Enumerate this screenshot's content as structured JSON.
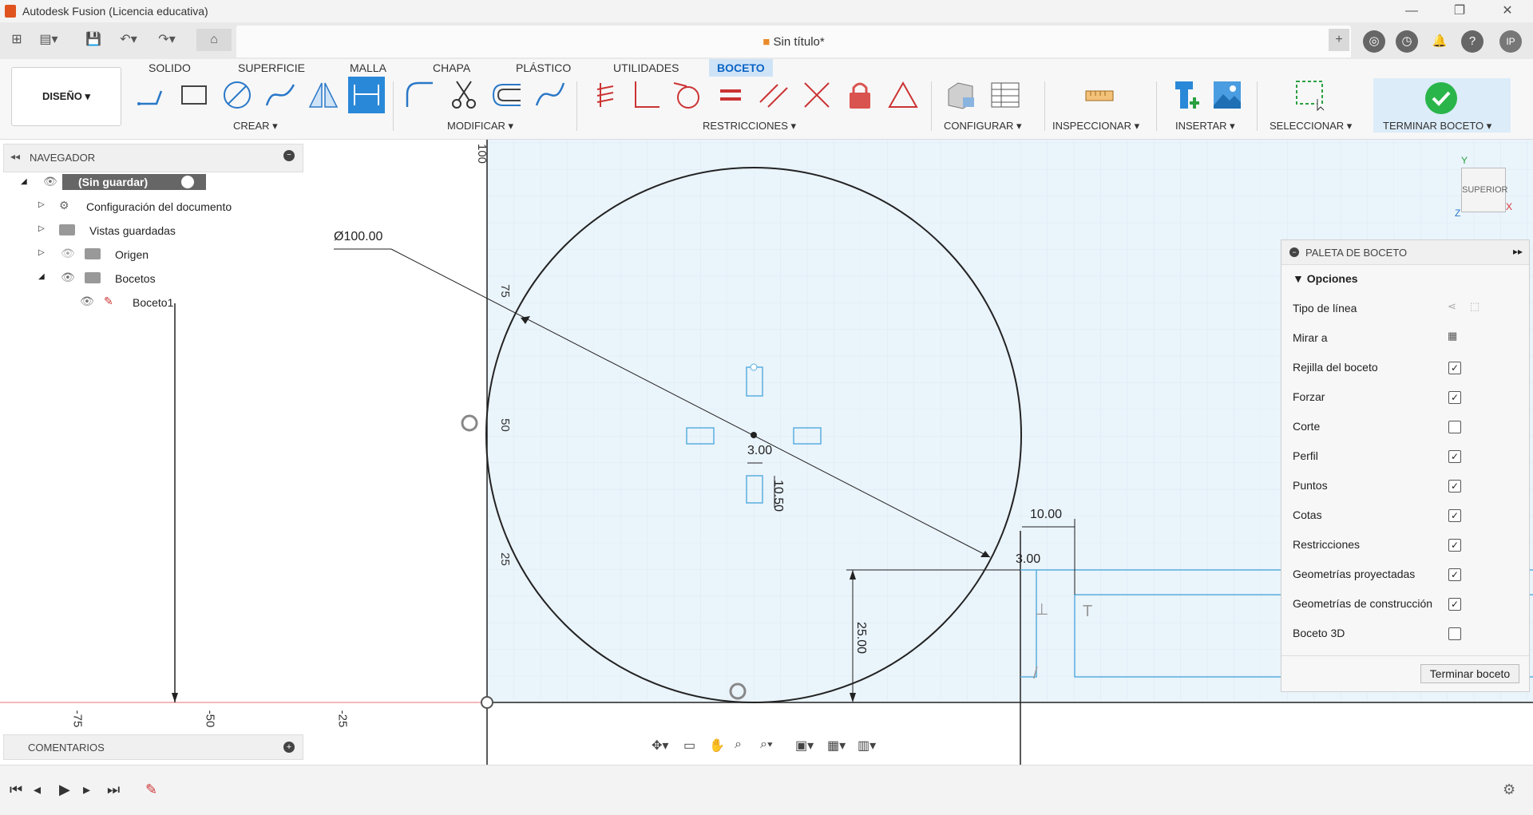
{
  "window": {
    "title": "Autodesk Fusion (Licencia educativa)"
  },
  "tabbar": {
    "doc_title": "Sin título*",
    "user_initials": "IP"
  },
  "ribbon": {
    "workspace": "DISEÑO ▾",
    "tabs": [
      "SOLIDO",
      "SUPERFICIE",
      "MALLA",
      "CHAPA",
      "PLÁSTICO",
      "UTILIDADES",
      "BOCETO"
    ],
    "active_tab": "BOCETO",
    "groups": {
      "crear": "CREAR ▾",
      "modificar": "MODIFICAR ▾",
      "restricciones": "RESTRICCIONES ▾",
      "configurar": "CONFIGURAR ▾",
      "inspeccionar": "INSPECCIONAR ▾",
      "insertar": "INSERTAR ▾",
      "seleccionar": "SELECCIONAR ▾",
      "terminar": "TERMINAR BOCETO ▾"
    },
    "accent": "#0a64c4"
  },
  "navigator": {
    "title": "NAVEGADOR",
    "root": "(Sin guardar)",
    "items": [
      {
        "label": "Configuración del documento",
        "icon": "gear-icon"
      },
      {
        "label": "Vistas guardadas",
        "icon": "folder-icon"
      },
      {
        "label": "Origen",
        "icon": "folder-icon"
      },
      {
        "label": "Bocetos",
        "icon": "folder-icon"
      },
      {
        "label": "Boceto1",
        "icon": "sketch-icon"
      }
    ]
  },
  "sketch": {
    "dim_diameter": "Ø100.00",
    "dim_a": "3.00",
    "dim_b": "10.50",
    "dim_c": "10.00",
    "dim_d": "3.00",
    "dim_e": "25.00",
    "ruler_v": [
      "100",
      "75",
      "50",
      "25"
    ],
    "ruler_h": [
      "-75",
      "-50",
      "-25"
    ]
  },
  "viewcube": {
    "face": "SUPERIOR",
    "axis_y": "Y",
    "axis_x": "X",
    "axis_z": "Z"
  },
  "palette": {
    "title": "PALETA DE BOCETO",
    "section": "Opciones",
    "rows": [
      {
        "label": "Tipo de línea",
        "kind": "icons"
      },
      {
        "label": "Mirar a",
        "kind": "icon"
      },
      {
        "label": "Rejilla del boceto",
        "checked": "✓"
      },
      {
        "label": "Forzar",
        "checked": "✓"
      },
      {
        "label": "Corte",
        "checked": ""
      },
      {
        "label": "Perfil",
        "checked": "✓"
      },
      {
        "label": "Puntos",
        "checked": "✓"
      },
      {
        "label": "Cotas",
        "checked": "✓"
      },
      {
        "label": "Restricciones",
        "checked": "✓"
      },
      {
        "label": "Geometrías proyectadas",
        "checked": "✓"
      },
      {
        "label": "Geometrías de construcción",
        "checked": "✓"
      },
      {
        "label": "Boceto 3D",
        "checked": ""
      }
    ],
    "finish_button": "Terminar boceto"
  },
  "comments": {
    "title": "COMENTARIOS"
  }
}
